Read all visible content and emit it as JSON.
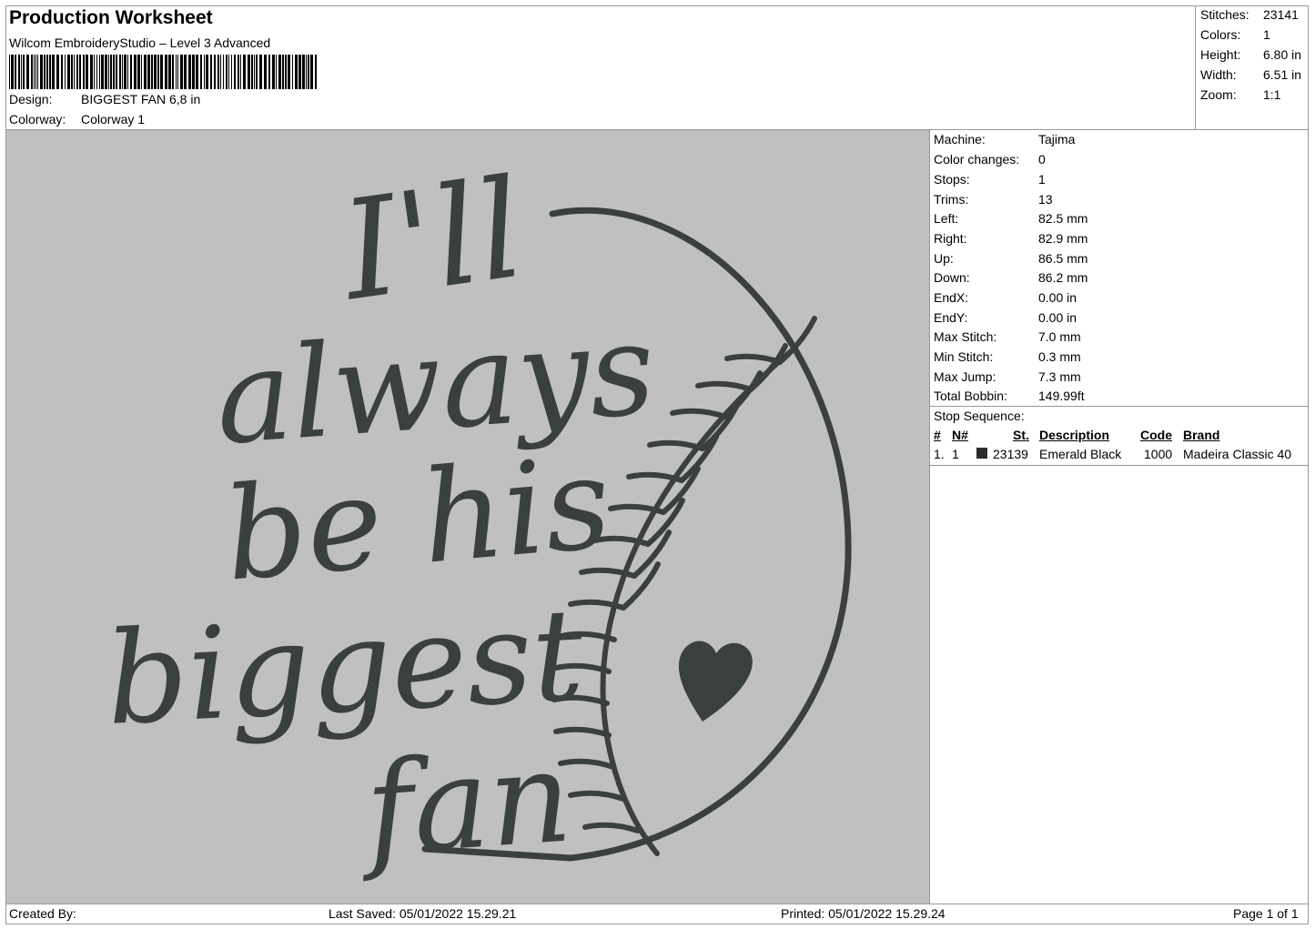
{
  "header": {
    "title": "Production Worksheet",
    "software": "Wilcom EmbroideryStudio – Level 3 Advanced",
    "design_label": "Design:",
    "design_value": "BIGGEST FAN 6,8 in",
    "colorway_label": "Colorway:",
    "colorway_value": "Colorway 1"
  },
  "summary": [
    {
      "key": "Stitches:",
      "value": "23141"
    },
    {
      "key": "Colors:",
      "value": "1"
    },
    {
      "key": "Height:",
      "value": "6.80 in"
    },
    {
      "key": "Width:",
      "value": "6.51 in"
    },
    {
      "key": "Zoom:",
      "value": "1:1"
    }
  ],
  "machine_info": [
    {
      "key": "Machine:",
      "value": "Tajima"
    },
    {
      "key": "Color changes:",
      "value": "0"
    },
    {
      "key": "Stops:",
      "value": "1"
    },
    {
      "key": "Trims:",
      "value": "13"
    },
    {
      "key": "Left:",
      "value": "82.5 mm"
    },
    {
      "key": "Right:",
      "value": "82.9 mm"
    },
    {
      "key": "Up:",
      "value": "86.5 mm"
    },
    {
      "key": "Down:",
      "value": "86.2 mm"
    },
    {
      "key": "EndX:",
      "value": "0.00 in"
    },
    {
      "key": "EndY:",
      "value": "0.00 in"
    },
    {
      "key": "Max Stitch:",
      "value": "7.0 mm"
    },
    {
      "key": "Min Stitch:",
      "value": "0.3 mm"
    },
    {
      "key": "Max Jump:",
      "value": "7.3 mm"
    },
    {
      "key": "Total Bobbin:",
      "value": "149.99ft"
    }
  ],
  "stop_sequence": {
    "label": "Stop Sequence:",
    "headers": {
      "num": "#",
      "n": "N#",
      "st": "St.",
      "description": "Description",
      "code": "Code",
      "brand": "Brand"
    },
    "rows": [
      {
        "num": "1.",
        "n": "1",
        "st": "23139",
        "description": "Emerald Black",
        "code": "1000",
        "brand": "Madeira Classic 40",
        "color": "#2b2b2b"
      }
    ]
  },
  "design_text": [
    "I'll",
    "always",
    "be his",
    "biggest",
    "fan"
  ],
  "colors": {
    "thread": "#3a403c",
    "background": "#c0c0c0",
    "border": "#999999"
  },
  "footer": {
    "created_by": "Created By:",
    "last_saved": "Last Saved: 05/01/2022 15.29.21",
    "printed": "Printed: 05/01/2022 15.29.24",
    "page": "Page 1 of 1"
  }
}
